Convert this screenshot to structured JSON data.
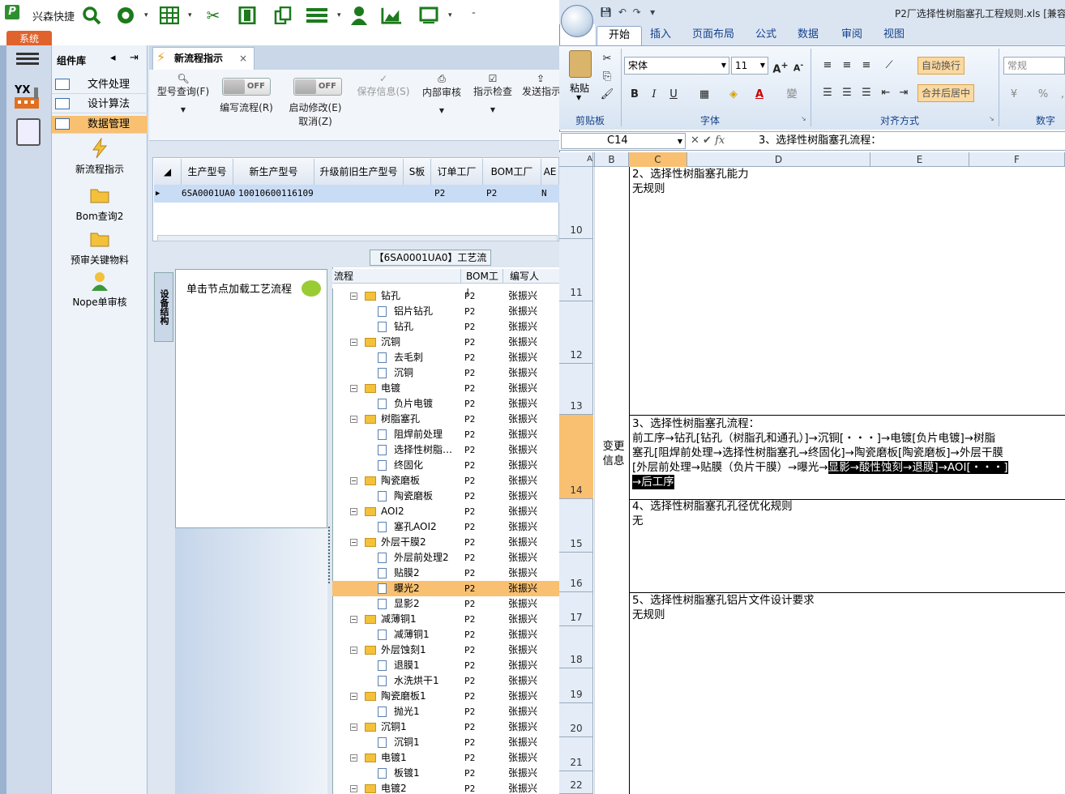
{
  "app": {
    "title": "兴森快捷",
    "system_tab": "系统"
  },
  "toolbar_icons": [
    "search-icon",
    "lifebuoy-icon",
    "grid-icon",
    "scissors-icon",
    "film-icon",
    "copy-icon",
    "list-icon",
    "user-icon",
    "chart-icon",
    "window-icon"
  ],
  "component_panel": {
    "title": "组件库",
    "menus": [
      {
        "label": "文件处理"
      },
      {
        "label": "设计算法"
      },
      {
        "label": "数据管理"
      }
    ],
    "items": [
      {
        "label": "新流程指示"
      },
      {
        "label": "Bom查询2"
      },
      {
        "label": "预审关键物料"
      },
      {
        "label": "Nope单审核"
      }
    ]
  },
  "tab": {
    "label": "新流程指示",
    "close": "×"
  },
  "tools": {
    "model_query": "型号查询(F)",
    "edit_flow": "编写流程(R)",
    "edit_flow_toggle": "OFF",
    "start_modify": "启动修改(E)",
    "start_modify_toggle": "OFF",
    "cancel": "取消(Z)",
    "save_info": "保存信息(S)",
    "internal_review": "内部审核",
    "instruction_check": "指示检查",
    "send": "发送指示"
  },
  "grid": {
    "headers": [
      "生产型号",
      "新生产型号",
      "升级前旧生产型号",
      "S板",
      "订单工厂",
      "BOM工厂",
      "AE"
    ],
    "row": [
      "6SA0001UA0",
      "10010600116109",
      "",
      "",
      "P2",
      "P2",
      "N"
    ]
  },
  "process": {
    "title": "【6SA0001UA0】工艺流程",
    "vertical_tab": "设备结构",
    "click_hint": "单击节点加载工艺流程",
    "headers": {
      "flow": "流程",
      "bom": "BOM工厂",
      "writer": "编写人"
    },
    "rows": [
      {
        "name": "钻孔",
        "level": 0,
        "bom": "P2",
        "writer": "张振兴"
      },
      {
        "name": "铝片钻孔",
        "level": 1,
        "bom": "P2",
        "writer": "张振兴"
      },
      {
        "name": "钻孔",
        "level": 1,
        "bom": "P2",
        "writer": "张振兴"
      },
      {
        "name": "沉铜",
        "level": 0,
        "bom": "P2",
        "writer": "张振兴"
      },
      {
        "name": "去毛刺",
        "level": 1,
        "bom": "P2",
        "writer": "张振兴"
      },
      {
        "name": "沉铜",
        "level": 1,
        "bom": "P2",
        "writer": "张振兴"
      },
      {
        "name": "电镀",
        "level": 0,
        "bom": "P2",
        "writer": "张振兴"
      },
      {
        "name": "负片电镀",
        "level": 1,
        "bom": "P2",
        "writer": "张振兴"
      },
      {
        "name": "树脂塞孔",
        "level": 0,
        "bom": "P2",
        "writer": "张振兴"
      },
      {
        "name": "阻焊前处理",
        "level": 1,
        "bom": "P2",
        "writer": "张振兴"
      },
      {
        "name": "选择性树脂…",
        "level": 1,
        "bom": "P2",
        "writer": "张振兴"
      },
      {
        "name": "终固化",
        "level": 1,
        "bom": "P2",
        "writer": "张振兴"
      },
      {
        "name": "陶瓷磨板",
        "level": 0,
        "bom": "P2",
        "writer": "张振兴"
      },
      {
        "name": "陶瓷磨板",
        "level": 1,
        "bom": "P2",
        "writer": "张振兴"
      },
      {
        "name": "AOI2",
        "level": 0,
        "bom": "P2",
        "writer": "张振兴"
      },
      {
        "name": "塞孔AOI2",
        "level": 1,
        "bom": "P2",
        "writer": "张振兴"
      },
      {
        "name": "外层干膜2",
        "level": 0,
        "bom": "P2",
        "writer": "张振兴"
      },
      {
        "name": "外层前处理2",
        "level": 1,
        "bom": "P2",
        "writer": "张振兴"
      },
      {
        "name": "贴膜2",
        "level": 1,
        "bom": "P2",
        "writer": "张振兴"
      },
      {
        "name": "曝光2",
        "level": 1,
        "bom": "P2",
        "writer": "张振兴",
        "selected": true
      },
      {
        "name": "显影2",
        "level": 1,
        "bom": "P2",
        "writer": "张振兴"
      },
      {
        "name": "减薄铜1",
        "level": 0,
        "bom": "P2",
        "writer": "张振兴"
      },
      {
        "name": "减薄铜1",
        "level": 1,
        "bom": "P2",
        "writer": "张振兴"
      },
      {
        "name": "外层蚀刻1",
        "level": 0,
        "bom": "P2",
        "writer": "张振兴"
      },
      {
        "name": "退膜1",
        "level": 1,
        "bom": "P2",
        "writer": "张振兴"
      },
      {
        "name": "水洗烘干1",
        "level": 1,
        "bom": "P2",
        "writer": "张振兴"
      },
      {
        "name": "陶瓷磨板1",
        "level": 0,
        "bom": "P2",
        "writer": "张振兴"
      },
      {
        "name": "抛光1",
        "level": 1,
        "bom": "P2",
        "writer": "张振兴"
      },
      {
        "name": "沉铜1",
        "level": 0,
        "bom": "P2",
        "writer": "张振兴"
      },
      {
        "name": "沉铜1",
        "level": 1,
        "bom": "P2",
        "writer": "张振兴"
      },
      {
        "name": "电镀1",
        "level": 0,
        "bom": "P2",
        "writer": "张振兴"
      },
      {
        "name": "板镀1",
        "level": 1,
        "bom": "P2",
        "writer": "张振兴"
      },
      {
        "name": "电镀2",
        "level": 0,
        "bom": "P2",
        "writer": "张振兴"
      }
    ]
  },
  "excel": {
    "title": "P2厂选择性树脂塞孔工程规则.xls  [兼容",
    "tabs": [
      "开始",
      "插入",
      "页面布局",
      "公式",
      "数据",
      "审阅",
      "视图"
    ],
    "font_name": "宋体",
    "font_size": "11",
    "paste": "粘贴",
    "wrap_text": "自动换行",
    "merge_center": "合并后居中",
    "number_format": "常规",
    "groups": {
      "clipboard": "剪贴板",
      "font": "字体",
      "align": "对齐方式",
      "number": "数字"
    },
    "name_box": "C14",
    "formula": "3、选择性树脂塞孔流程：",
    "columns": [
      "A",
      "B",
      "C",
      "D",
      "E",
      "F"
    ],
    "rows": [
      "10",
      "11",
      "12",
      "13",
      "14",
      "15",
      "16",
      "17",
      "18",
      "19",
      "20",
      "21",
      "22"
    ],
    "b_label": "变更\n信息",
    "cells": {
      "c2_title": "2、选择性树脂塞孔能力",
      "c2_value": "无规则",
      "c3_title": "3、选择性树脂塞孔流程：",
      "c3_line1": "前工序→钻孔[钻孔（树脂孔和通孔）]→沉铜[・・・]→电镀[负片电镀]→树脂",
      "c3_line2": "塞孔[阻焊前处理→选择性树脂塞孔→终固化]→陶瓷磨板[陶瓷磨板]→外层干膜",
      "c3_line3a": "[外层前处理→贴膜（负片干膜）→曝光→",
      "c3_line3b": "显影→酸性蚀刻→退膜]→AOI[・・・]",
      "c3_line4": "→后工序",
      "c4_title": "4、选择性树脂塞孔孔径优化规则",
      "c4_value": "无",
      "c5_title": "5、选择性树脂塞孔铝片文件设计要求",
      "c5_value": "无规则"
    }
  },
  "colors": {
    "accent_orange": "#f8c070",
    "green": "#1c7a1c",
    "system_tab": "#e0622d"
  }
}
